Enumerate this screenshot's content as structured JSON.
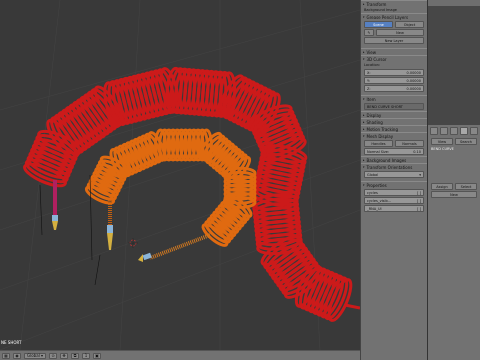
{
  "viewport": {
    "bottom_left_label": "NE SHORT",
    "coils": {
      "red": "#cc1a1a",
      "orange": "#e06a10"
    }
  },
  "header": {
    "mode": "Global",
    "layer_num": "1",
    "frame": "0"
  },
  "npanel": {
    "transform": "Transform",
    "background_label": "Background Image",
    "grease_pencil": "Grease Pencil Layers",
    "scene_btn": "Scene",
    "object_btn": "Object",
    "new_btn": "New",
    "new_layer_btn": "New Layer",
    "view": "View",
    "cursor": "3D Cursor",
    "location_label": "Location:",
    "x_label": "X:",
    "x_val": "0.00000",
    "y_label": "Y:",
    "y_val": "0.00000",
    "z_label": "Z:",
    "z_val": "0.00000",
    "item": "Item",
    "item_name": "BEND CURVE SHORT",
    "display": "Display",
    "shading": "Shading",
    "motion_tracking": "Motion Tracking",
    "mesh_display": "Mesh Display",
    "handles": "Handles",
    "normals": "Normals",
    "normal_size_label": "Normal Size:",
    "normal_size_val": "0.10",
    "background_images": "Background Images",
    "transform_orientations": "Transform Orientations",
    "global_select": "Global",
    "properties": "Properties",
    "prop1": "cycles",
    "prop2": "cycles_visib...",
    "prop3": "_RNA_UI",
    "prop_btn": "[ ]"
  },
  "outliner": {
    "item1": "BEND CURVE"
  },
  "props_panel": {
    "view_label": "View",
    "search_label": "Search",
    "assign": "Assign",
    "select": "Select",
    "new": "New"
  }
}
